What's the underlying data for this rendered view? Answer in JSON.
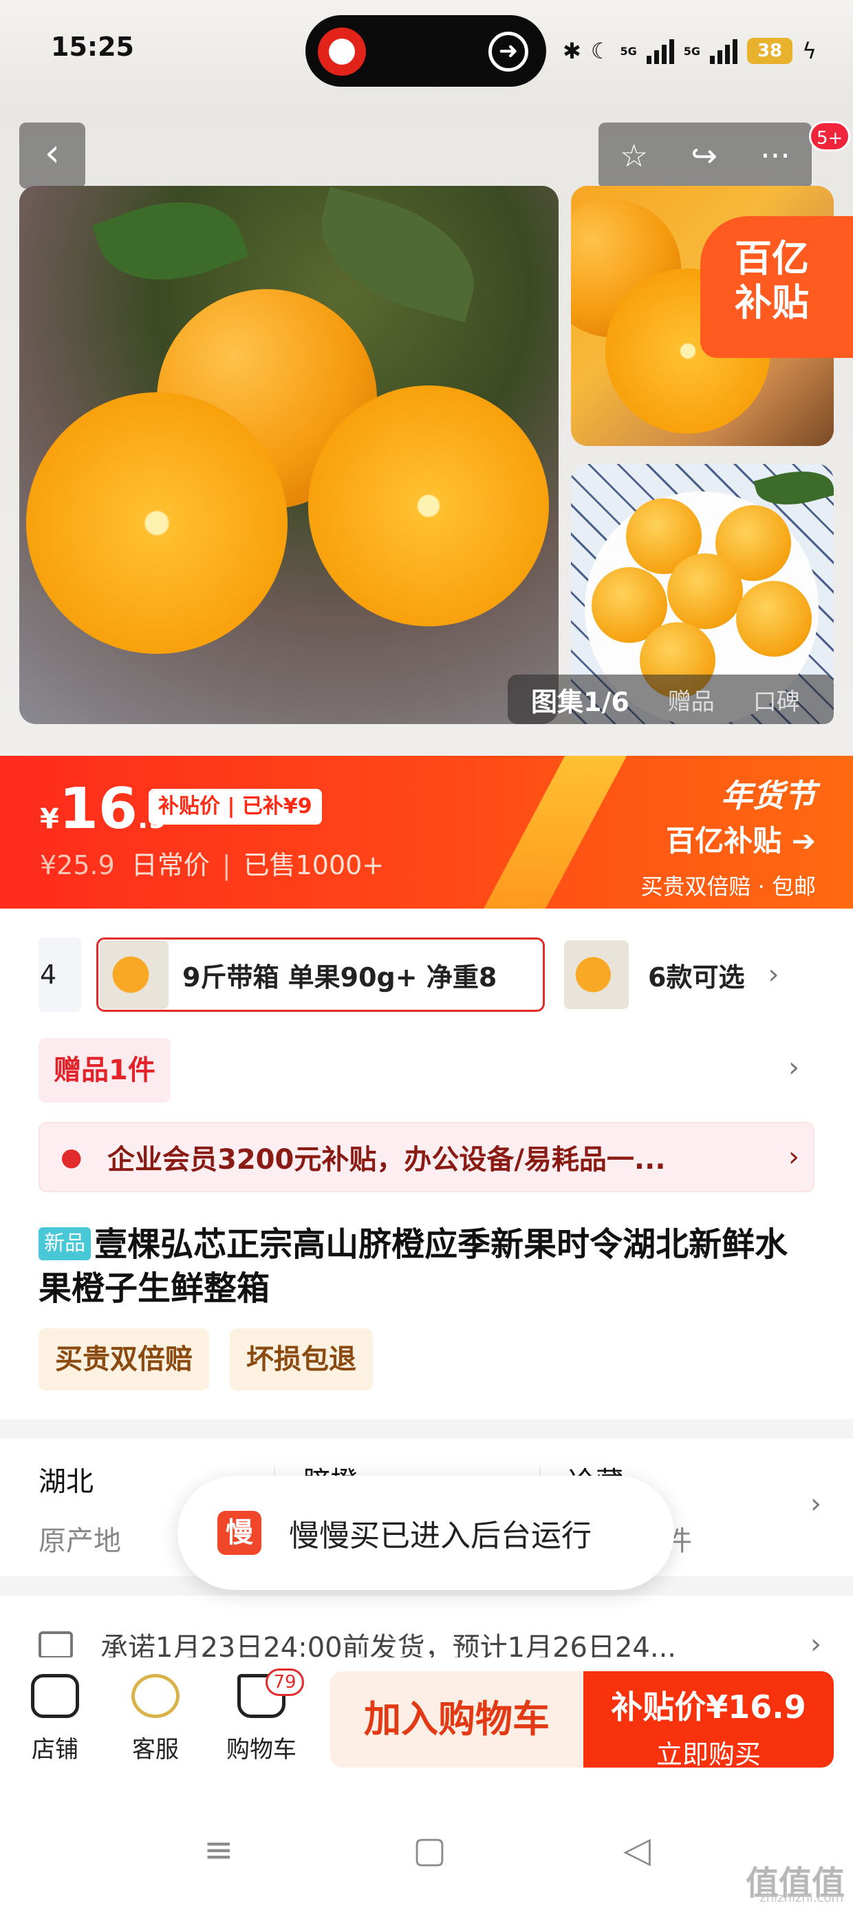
{
  "status": {
    "time": "15:25",
    "battery": "38",
    "signal1": "5G",
    "signal2": "5G"
  },
  "gallery": {
    "badge": "5+",
    "subsidy_tag_line1": "百亿",
    "subsidy_tag_line2": "补贴",
    "pills": [
      "图集1/6",
      "赠品",
      "口碑"
    ]
  },
  "price": {
    "currency": "¥",
    "integer": "16",
    "decimal": ".9",
    "subsidy_label": "补贴价 | 已补¥9",
    "original": "¥25.9",
    "original_label": "日常价",
    "sold": "已售1000+",
    "festival_title": "年货节",
    "festival_sub": "百亿补贴",
    "festival_note": "买贵双倍赔 · 包邮"
  },
  "sku": {
    "prev_text": "4",
    "selected": "9斤带箱 单果90g+ 净重8",
    "more": "6款可选"
  },
  "gift": "赠品1件",
  "member": "企业会员3200元补贴，办公设备/易耗品一...",
  "product": {
    "new_tag": "新品",
    "title": "壹棵弘芯正宗高山脐橙应季新果时令湖北新鲜水果橙子生鲜整箱",
    "tags": [
      "买贵双倍赔",
      "坏损包退"
    ]
  },
  "attributes": [
    {
      "value": "湖北",
      "key": "原产地"
    },
    {
      "value": "脐橙",
      "key": ""
    },
    {
      "value": "冷藏",
      "key": "件"
    }
  ],
  "toast": {
    "icon": "慢",
    "text": "慢慢买已进入后台运行"
  },
  "shipping": "承诺1月23日24:00前发货，预计1月26日24...",
  "bottom": {
    "store": "店铺",
    "service": "客服",
    "cart": "购物车",
    "cart_count": "79",
    "add_cart": "加入购物车",
    "buy_line1": "补贴价¥16.9",
    "buy_line2": "立即购买"
  },
  "watermark": "值值值",
  "watermark_url": "zhizhizhi.com"
}
